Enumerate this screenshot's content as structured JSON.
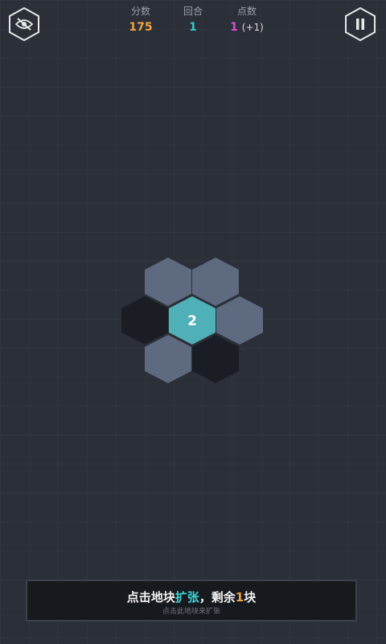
{
  "header": {
    "score_label": "分数",
    "score_value": "175",
    "round_label": "回合",
    "round_value": "1",
    "points_label": "点数",
    "points_value": "1",
    "points_bonus": "(+1)"
  },
  "icons": {
    "left": "eye-slash-icon",
    "right": "pause-icon"
  },
  "board": {
    "center_value": "2",
    "colors": {
      "gray": "#5e6a80",
      "dark": "#1a1d24",
      "cyan": "#4fb0b8"
    }
  },
  "banner": {
    "part1": "点击地块",
    "highlight1": "扩张",
    "part2": "，剩余",
    "highlight2": "1",
    "part3": "块",
    "hint": "点击此地块来扩张"
  },
  "colors": {
    "background": "#2b2f37",
    "score": "#f0a341",
    "round": "#33c7c9",
    "points": "#d34fd6"
  }
}
